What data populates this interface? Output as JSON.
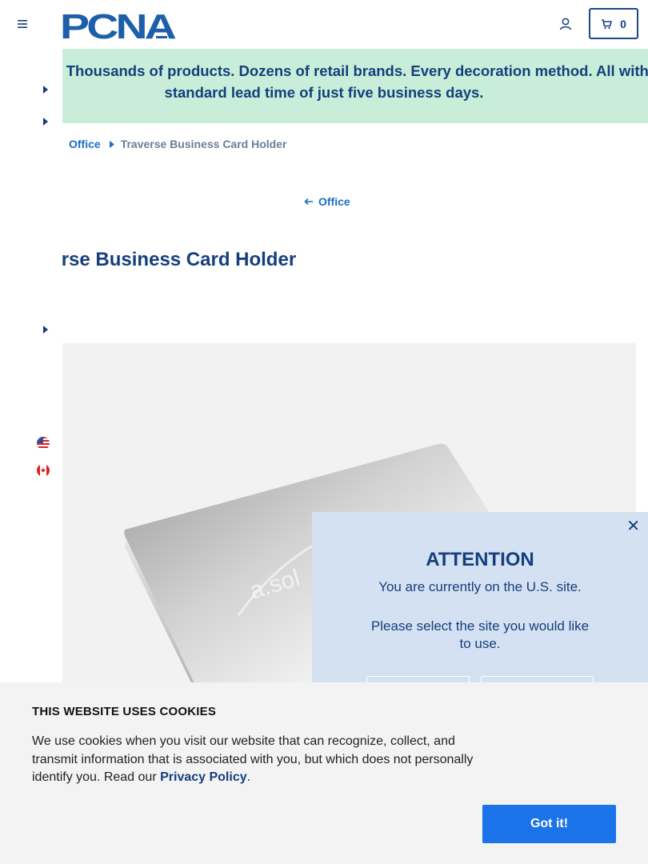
{
  "header": {
    "logo_text": "PCNA",
    "cart_count": "0",
    "icons": [
      "menu-icon",
      "account-icon",
      "cart-icon"
    ]
  },
  "promo": {
    "text": "Why Wait? Thousands of products. Dozens of retail brands. Every decoration method. All with a standard lead time of just five business days."
  },
  "left_rail": {
    "icons": [
      "caret-right-icon",
      "caret-right-icon",
      "caret-right-icon",
      "us-flag-icon",
      "canada-flag-icon"
    ]
  },
  "breadcrumb": {
    "parent": "Office",
    "current": "Traverse Business Card Holder"
  },
  "back_link": "Office",
  "product": {
    "title": "Traverse Business Card Holder"
  },
  "attention": {
    "title": "ATTENTION",
    "line1": "You are currently on the U.S. site.",
    "line2": "Please select the site you would like to use."
  },
  "cookie": {
    "title": "THIS WEBSITE USES COOKIES",
    "text": "We use cookies when you visit our website that can recognize, collect, and transmit information that is associated with you, but which does not personally identify you. Read our ",
    "link": "Privacy Policy",
    "end": ".",
    "button": "Got it!"
  },
  "colors": {
    "brand_navy": "#153f7c",
    "link_blue": "#1a6fc4",
    "promo_bg": "#c8eed9",
    "modal_bg": "#d4e1f2",
    "cookie_button": "#1a73e8"
  }
}
